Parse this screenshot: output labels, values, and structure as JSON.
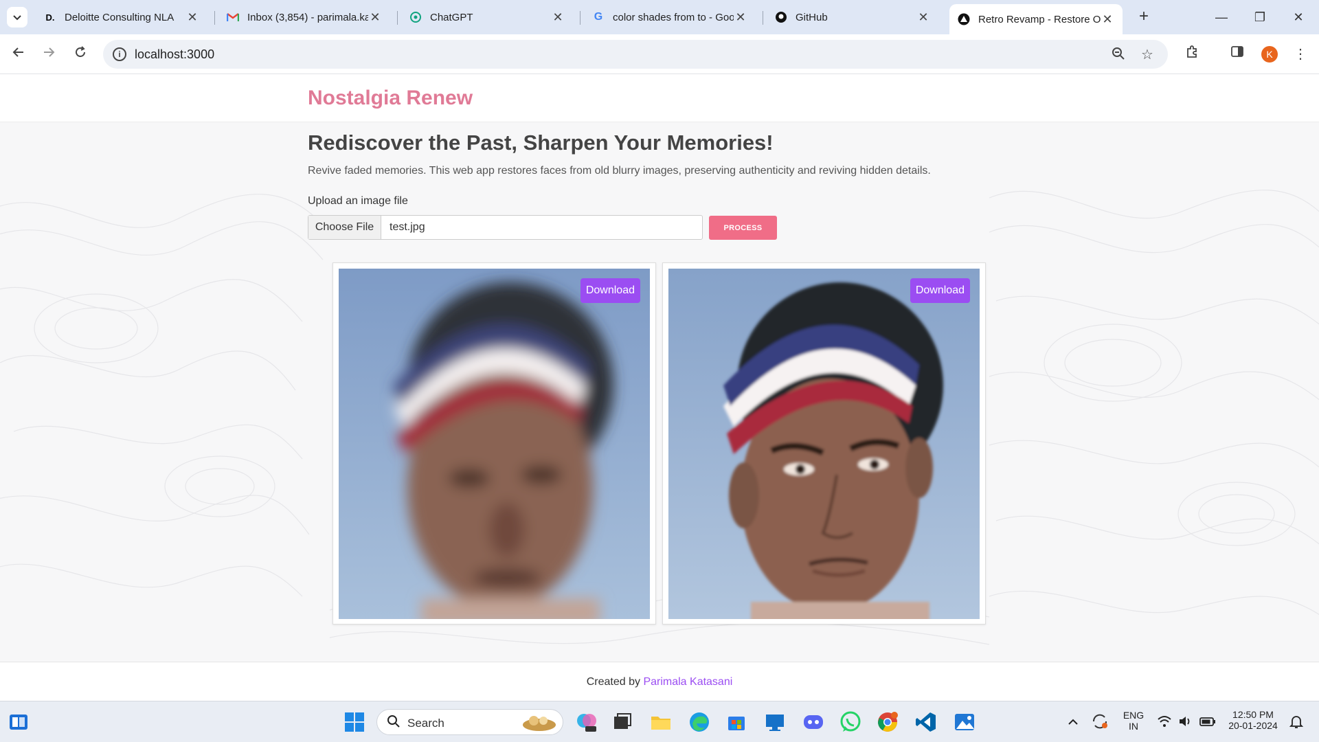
{
  "browser": {
    "tabs": [
      {
        "title": "Deloitte Consulting NLA",
        "icon": "deloitte-favicon",
        "active": false
      },
      {
        "title": "Inbox (3,854) - parimala.ka",
        "icon": "gmail-favicon",
        "active": false
      },
      {
        "title": "ChatGPT",
        "icon": "chatgpt-favicon",
        "active": false
      },
      {
        "title": "color shades from to - Goo",
        "icon": "google-favicon",
        "active": false
      },
      {
        "title": "GitHub",
        "icon": "github-favicon",
        "active": false
      },
      {
        "title": "Retro Revamp - Restore Ol",
        "icon": "retro-revamp-favicon",
        "active": true
      }
    ],
    "url": "localhost:3000",
    "profile_initial": "K"
  },
  "site": {
    "brand": "Nostalgia Renew",
    "brand_color": "#e07a96",
    "hero_title": "Rediscover the Past, Sharpen Your Memories!",
    "hero_desc": "Revive faded memories. This web app restores faces from old blurry images, preserving authenticity and reviving hidden details.",
    "upload_label": "Upload an image file",
    "choose_file_label": "Choose File",
    "file_name": "test.jpg",
    "process_label": "PROCESS",
    "process_color": "#f06d87",
    "images": [
      {
        "kind": "original",
        "download_label": "Download"
      },
      {
        "kind": "restored",
        "download_label": "Download"
      }
    ],
    "download_color": "#9b4df2",
    "footer_prefix": "Created by",
    "footer_author": "Parimala Katasani"
  },
  "taskbar": {
    "search_label": "Search",
    "lang_top": "ENG",
    "lang_bottom": "IN",
    "time": "12:50 PM",
    "date": "20-01-2024"
  }
}
